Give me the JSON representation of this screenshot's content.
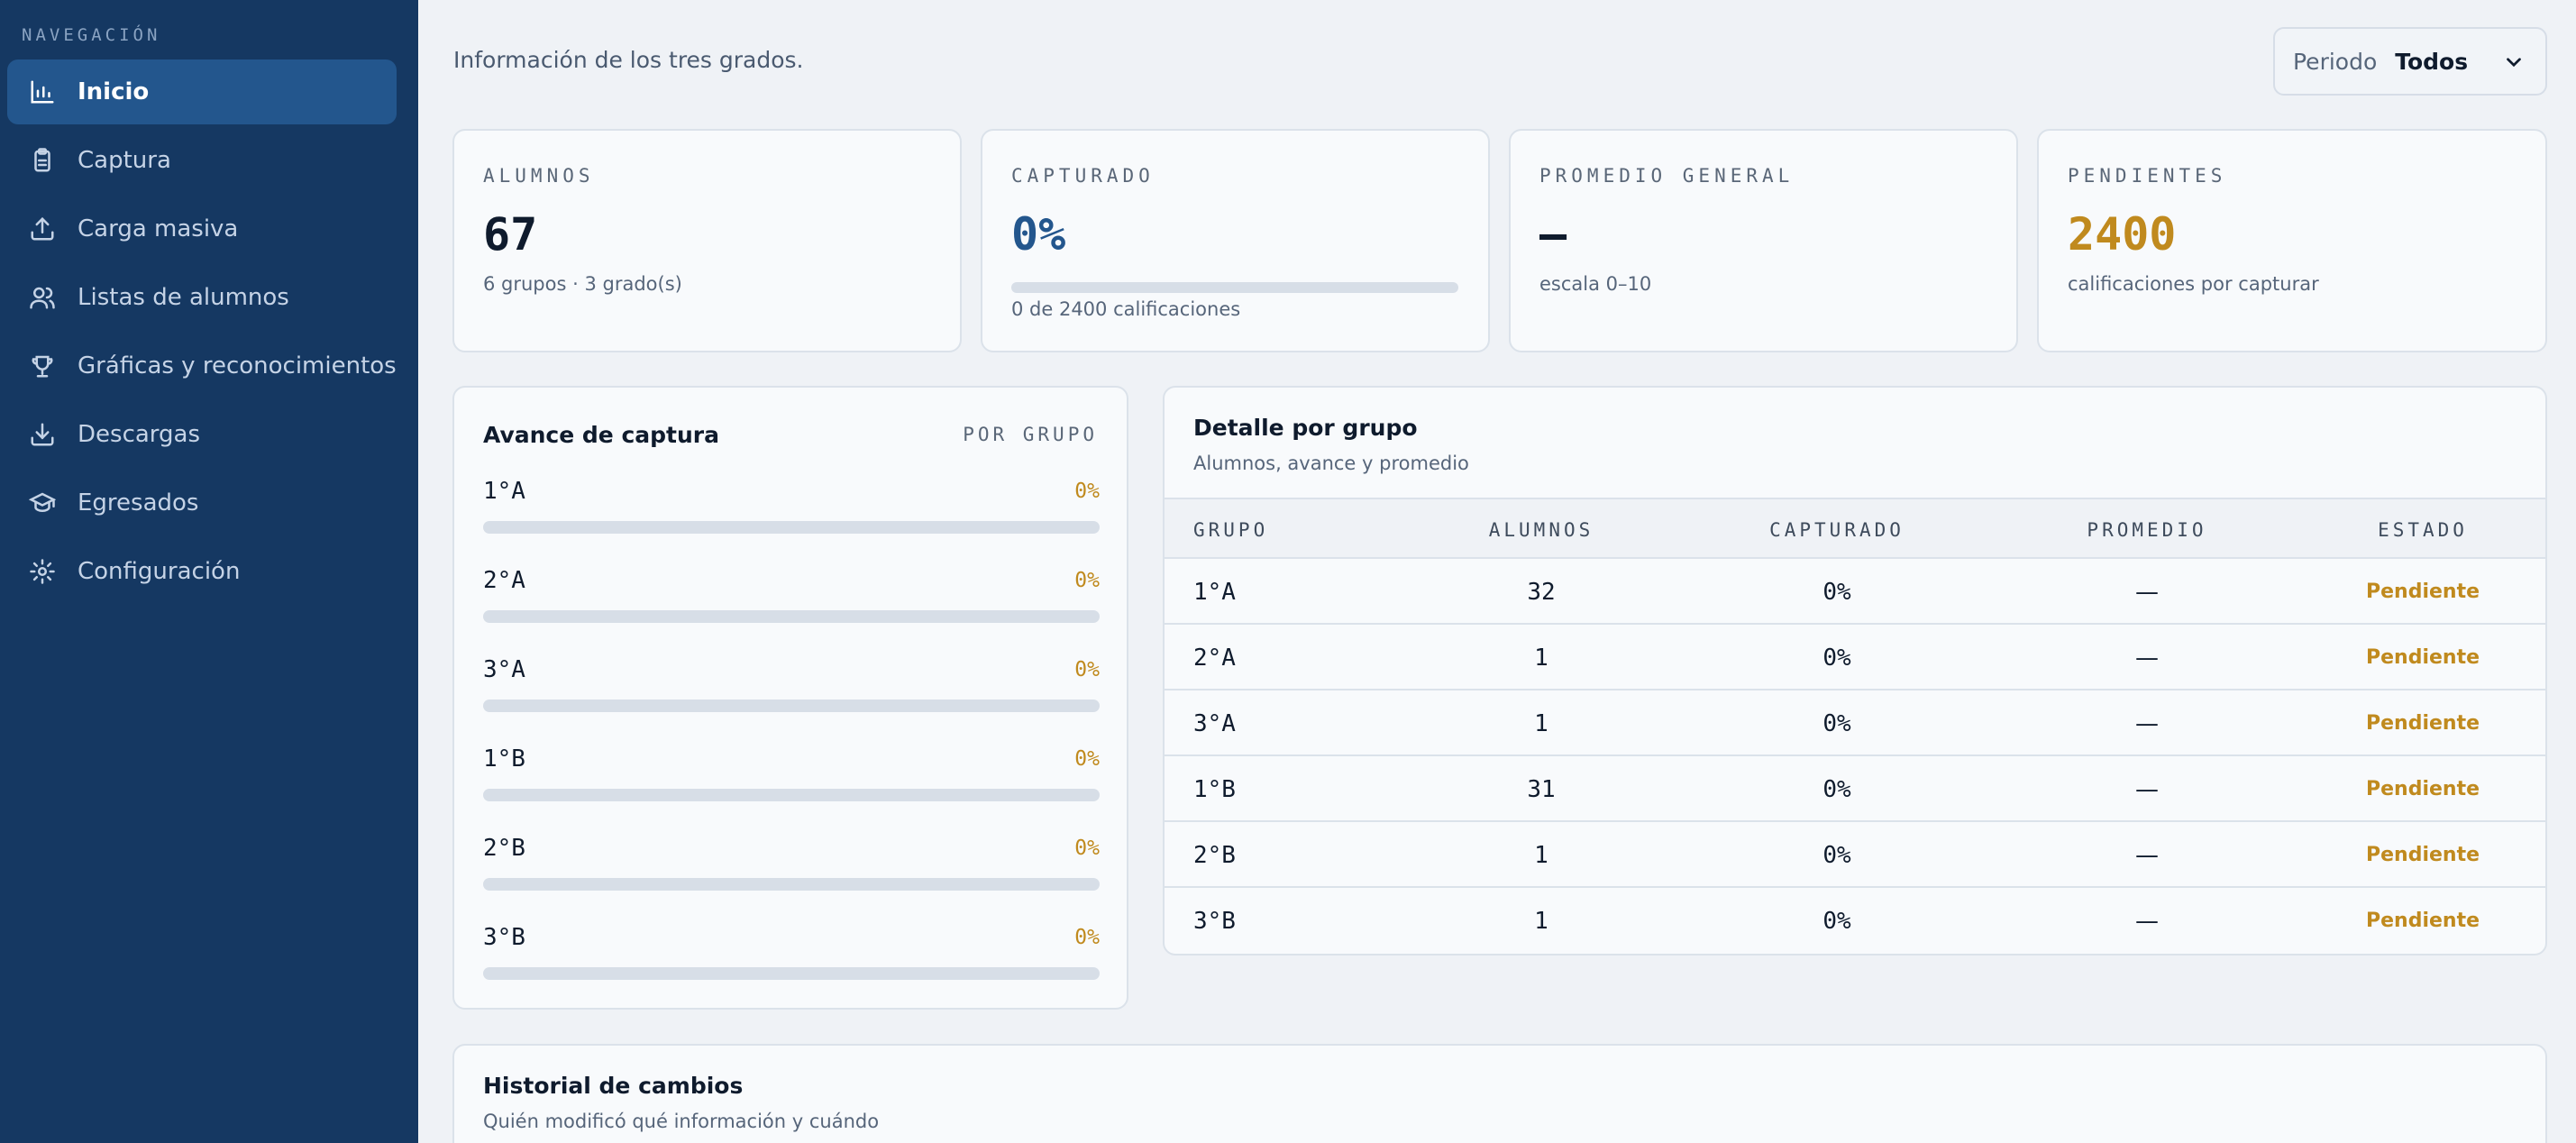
{
  "sidebar": {
    "heading": "NAVEGACIÓN",
    "items": [
      {
        "label": "Inicio",
        "icon": "bar-chart-icon",
        "active": true
      },
      {
        "label": "Captura",
        "icon": "clipboard-icon"
      },
      {
        "label": "Carga masiva",
        "icon": "upload-icon"
      },
      {
        "label": "Listas de alumnos",
        "icon": "users-icon"
      },
      {
        "label": "Gráficas y reconocimientos",
        "icon": "trophy-icon"
      },
      {
        "label": "Descargas",
        "icon": "download-icon"
      },
      {
        "label": "Egresados",
        "icon": "graduation-cap-icon"
      },
      {
        "label": "Configuración",
        "icon": "gear-icon"
      }
    ]
  },
  "header": {
    "intro": "Información de los tres grados.",
    "period_label": "Periodo",
    "period_value": "Todos"
  },
  "stats": {
    "alumnos": {
      "label": "ALUMNOS",
      "value": "67",
      "sub": "6 grupos · 3 grado(s)"
    },
    "capturado": {
      "label": "CAPTURADO",
      "value": "0%",
      "progress": 0,
      "sub": "0 de 2400 calificaciones"
    },
    "promedio": {
      "label": "PROMEDIO GENERAL",
      "value": "—",
      "sub": "escala 0–10"
    },
    "pendientes": {
      "label": "PENDIENTES",
      "value": "2400",
      "sub": "calificaciones por capturar"
    }
  },
  "progress_panel": {
    "title": "Avance de captura",
    "tag": "POR GRUPO",
    "rows": [
      {
        "group": "1°A",
        "pct_label": "0%",
        "pct": 0
      },
      {
        "group": "2°A",
        "pct_label": "0%",
        "pct": 0
      },
      {
        "group": "3°A",
        "pct_label": "0%",
        "pct": 0
      },
      {
        "group": "1°B",
        "pct_label": "0%",
        "pct": 0
      },
      {
        "group": "2°B",
        "pct_label": "0%",
        "pct": 0
      },
      {
        "group": "3°B",
        "pct_label": "0%",
        "pct": 0
      }
    ]
  },
  "detail_table": {
    "title": "Detalle por grupo",
    "subtitle": "Alumnos, avance y promedio",
    "columns": [
      "GRUPO",
      "ALUMNOS",
      "CAPTURADO",
      "PROMEDIO",
      "ESTADO"
    ],
    "rows": [
      {
        "grupo": "1°A",
        "alumnos": "32",
        "capturado": "0%",
        "promedio": "—",
        "estado": "Pendiente"
      },
      {
        "grupo": "2°A",
        "alumnos": "1",
        "capturado": "0%",
        "promedio": "—",
        "estado": "Pendiente"
      },
      {
        "grupo": "3°A",
        "alumnos": "1",
        "capturado": "0%",
        "promedio": "—",
        "estado": "Pendiente"
      },
      {
        "grupo": "1°B",
        "alumnos": "31",
        "capturado": "0%",
        "promedio": "—",
        "estado": "Pendiente"
      },
      {
        "grupo": "2°B",
        "alumnos": "1",
        "capturado": "0%",
        "promedio": "—",
        "estado": "Pendiente"
      },
      {
        "grupo": "3°B",
        "alumnos": "1",
        "capturado": "0%",
        "promedio": "—",
        "estado": "Pendiente"
      }
    ]
  },
  "history": {
    "title": "Historial de cambios",
    "subtitle": "Quién modificó qué información y cuándo"
  },
  "colors": {
    "sidebar_bg": "#153862",
    "active_item": "#23568d",
    "accent_blue": "#23568d",
    "pending_amber": "#c08a1e"
  }
}
